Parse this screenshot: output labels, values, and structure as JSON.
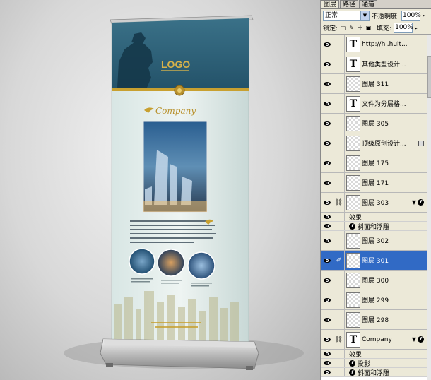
{
  "panel": {
    "tabs": [
      "图层",
      "路径",
      "通道"
    ],
    "blend_mode": "正常",
    "opacity_label": "不透明度:",
    "opacity_value": "100%",
    "lock_label": "锁定:",
    "fill_label": "填充:",
    "fill_value": "100%"
  },
  "banner": {
    "logo": "LOGO",
    "company": "Company"
  },
  "layers": [
    {
      "name": "http://hi.huit...",
      "kind": "text",
      "selected": false
    },
    {
      "name": "其他类型设计...",
      "kind": "text",
      "selected": false
    },
    {
      "name": "图层 311",
      "kind": "pixel",
      "selected": false
    },
    {
      "name": "文件为分层格...",
      "kind": "text",
      "selected": false
    },
    {
      "name": "图层 305",
      "kind": "pixel",
      "selected": false
    },
    {
      "name": "顶级原创设计...",
      "kind": "pixel",
      "selected": false,
      "locked": true
    },
    {
      "name": "图层 175",
      "kind": "pixel",
      "selected": false
    },
    {
      "name": "图层 171",
      "kind": "pixel",
      "selected": false
    },
    {
      "name": "图层 303",
      "kind": "pixel",
      "selected": false,
      "fx": true
    },
    {
      "name": "图层 302",
      "kind": "pixel",
      "selected": false
    },
    {
      "name": "图层 301",
      "kind": "pixel",
      "selected": true
    },
    {
      "name": "图层 300",
      "kind": "pixel",
      "selected": false
    },
    {
      "name": "图层 299",
      "kind": "pixel",
      "selected": false
    },
    {
      "name": "图层 298",
      "kind": "pixel",
      "selected": false
    },
    {
      "name": "Company",
      "kind": "text",
      "selected": false,
      "fx": true
    }
  ],
  "effects": {
    "header": "效果",
    "bevel": "斜面和浮雕",
    "shadow": "投影"
  },
  "colors": {
    "selection": "#316ac5",
    "banner_header": "#2e6078",
    "gold": "#c8a030"
  }
}
